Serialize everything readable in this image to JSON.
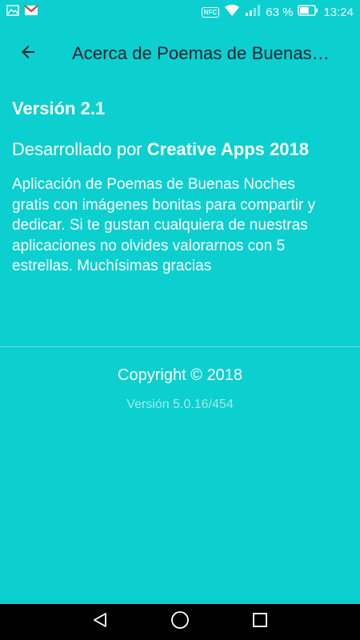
{
  "status_bar": {
    "nfc_label": "NFC",
    "battery_percent": "63 %",
    "time": "13:24",
    "icons": [
      "image-notification-icon",
      "gmail-icon",
      "nfc-icon",
      "wifi-icon",
      "signal-icon",
      "battery-icon"
    ],
    "battery_level": 0.63
  },
  "app_bar": {
    "title": "Acerca de Poemas de Buenas…",
    "back_icon": "arrow-left-icon"
  },
  "content": {
    "version_title": "Versión 2.1",
    "developer_prefix": "Desarrollado por ",
    "developer_name": "Creative Apps 2018",
    "description": "Aplicación de Poemas de Buenas Noches gratis con imágenes bonitas para compartir y dedicar. Si te gustan cualquiera de nuestras aplicaciones no olvides valorarnos con 5 estrellas. Muchísimas gracias"
  },
  "footer": {
    "copyright": "Copyright © 2018",
    "build_version": "Versión 5.0.16/454"
  },
  "nav_bar": {
    "icons": [
      "nav-back-icon",
      "nav-home-icon",
      "nav-recents-icon"
    ]
  },
  "colors": {
    "background": "#0ccfcf",
    "text": "#ffffff",
    "title": "#0b2330",
    "nav_bar": "#000000"
  }
}
